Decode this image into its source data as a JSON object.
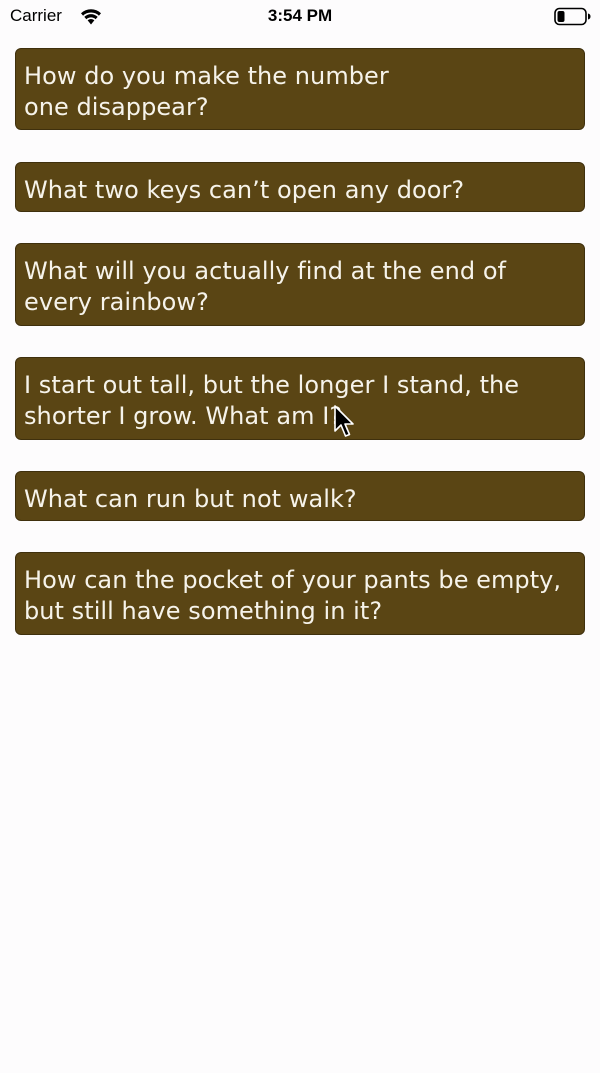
{
  "status_bar": {
    "carrier": "Carrier",
    "time": "3:54 PM",
    "icons": [
      "wifi-icon",
      "battery-icon"
    ]
  },
  "riddles": [
    {
      "text": "How do you make the number\none disappear?"
    },
    {
      "text": " What two keys can’t open any door?"
    },
    {
      "text": "What will you actually find at the end of\nevery rainbow?"
    },
    {
      "text": "I start out tall, but the longer I stand, the\nshorter I grow. What am I?"
    },
    {
      "text": "What can run but not walk?"
    },
    {
      "text": "How can the pocket of your pants be empty,\nbut still have something in it?"
    }
  ],
  "colors": {
    "button_background": "#5a4514",
    "button_text": "#f6f3ea",
    "page_background": "#fdfcfd"
  }
}
